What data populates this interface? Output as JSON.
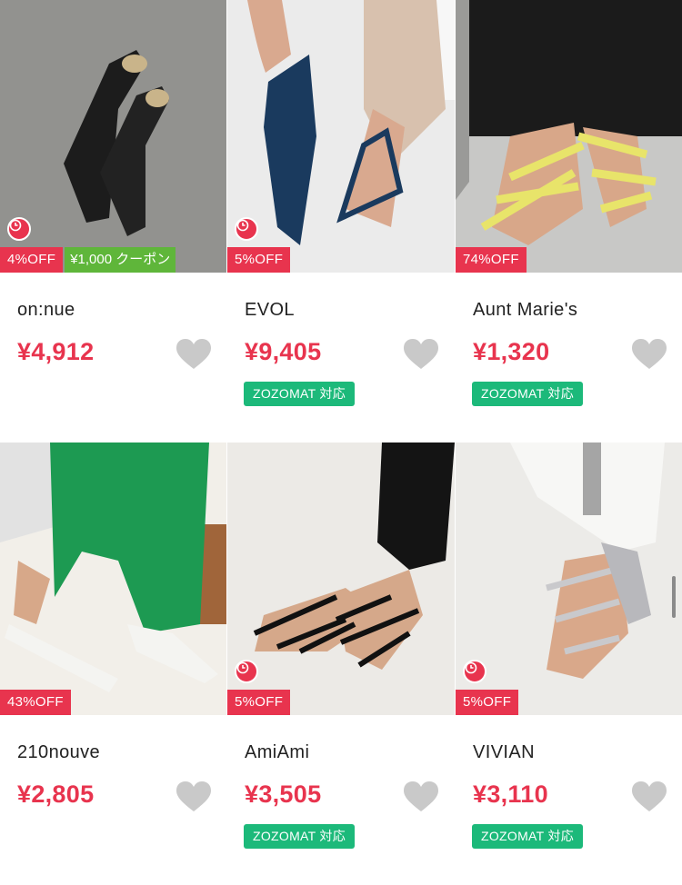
{
  "products": [
    {
      "brand": "on:nue",
      "price": "¥4,912",
      "discount": "4%OFF",
      "coupon": "¥1,000 クーポン",
      "timer": true,
      "zozomat": ""
    },
    {
      "brand": "EVOL",
      "price": "¥9,405",
      "discount": "5%OFF",
      "coupon": "",
      "timer": true,
      "zozomat": "ZOZOMAT 対応"
    },
    {
      "brand": "Aunt Marie's",
      "price": "¥1,320",
      "discount": "74%OFF",
      "coupon": "",
      "timer": false,
      "zozomat": "ZOZOMAT 対応"
    },
    {
      "brand": "210nouve",
      "price": "¥2,805",
      "discount": "43%OFF",
      "coupon": "",
      "timer": false,
      "zozomat": ""
    },
    {
      "brand": "AmiAmi",
      "price": "¥3,505",
      "discount": "5%OFF",
      "coupon": "",
      "timer": true,
      "zozomat": "ZOZOMAT 対応"
    },
    {
      "brand": "VIVIAN",
      "price": "¥3,110",
      "discount": "5%OFF",
      "coupon": "",
      "timer": true,
      "zozomat": "ZOZOMAT 対応"
    }
  ],
  "colors": {
    "sale_red": "#e8344e",
    "coupon_green": "#5fb63a",
    "zozomat_green": "#1cb97a",
    "heart_gray": "#c9c9c9"
  }
}
